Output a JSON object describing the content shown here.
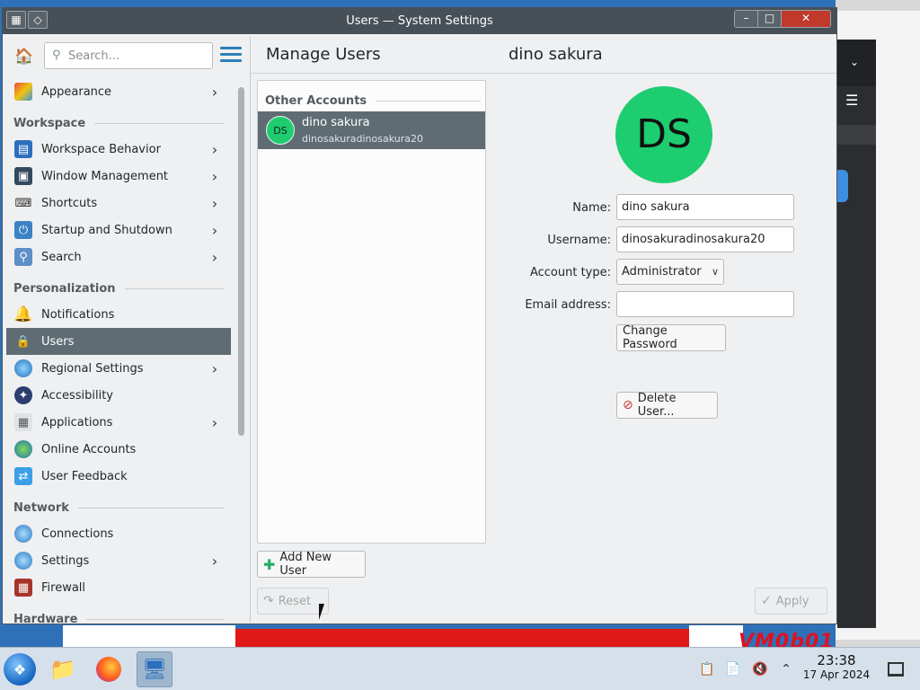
{
  "window": {
    "title": "Users — System Settings"
  },
  "sidebar": {
    "search_placeholder": "Search...",
    "items": [
      {
        "label": "Appearance",
        "icon": "appearance-icon",
        "top": 0,
        "chevron": true
      },
      {
        "label": "Workspace Behavior",
        "icon": "workspace-icon",
        "chevron": true
      },
      {
        "label": "Window Management",
        "icon": "window-icon",
        "chevron": true
      },
      {
        "label": "Shortcuts",
        "icon": "keyboard-icon",
        "chevron": true
      },
      {
        "label": "Startup and Shutdown",
        "icon": "startup-icon",
        "chevron": true
      },
      {
        "label": "Search",
        "icon": "search-icon",
        "chevron": true
      },
      {
        "label": "Notifications",
        "icon": "bell-icon",
        "chevron": false
      },
      {
        "label": "Users",
        "icon": "users-icon",
        "chevron": false,
        "selected": true
      },
      {
        "label": "Regional Settings",
        "icon": "globe-icon",
        "chevron": true
      },
      {
        "label": "Accessibility",
        "icon": "accessibility-icon",
        "chevron": false
      },
      {
        "label": "Applications",
        "icon": "applications-icon",
        "chevron": true
      },
      {
        "label": "Online Accounts",
        "icon": "online-accounts-icon",
        "chevron": false
      },
      {
        "label": "User Feedback",
        "icon": "feedback-icon",
        "chevron": false
      },
      {
        "label": "Connections",
        "icon": "network-icon",
        "chevron": false
      },
      {
        "label": "Settings",
        "icon": "network-settings-icon",
        "chevron": true
      },
      {
        "label": "Firewall",
        "icon": "firewall-icon",
        "chevron": false
      }
    ],
    "sections": [
      "Workspace",
      "Personalization",
      "Network",
      "Hardware"
    ]
  },
  "main": {
    "page_title": "Manage Users",
    "user_title": "dino sakura",
    "accounts_section": "Other Accounts",
    "account": {
      "initials": "DS",
      "name": "dino sakura",
      "username": "dinosakuradinosakura20"
    },
    "add_user_label": "Add New User",
    "reset_label": "Reset",
    "apply_label": "Apply"
  },
  "form": {
    "avatar_initials": "DS",
    "name_label": "Name:",
    "name_value": "dino sakura",
    "username_label": "Username:",
    "username_value": "dinosakuradinosakura20",
    "account_type_label": "Account type:",
    "account_type_value": "Administrator",
    "email_label": "Email address:",
    "email_value": "",
    "change_password_label": "Change Password",
    "delete_user_label": "Delete User..."
  },
  "taskbar": {
    "time": "23:38",
    "date": "17 Apr 2024"
  },
  "desktop": {
    "watermark": "VM0b01"
  },
  "colors": {
    "accent": "#2980b9",
    "selection": "#5f6c73",
    "avatar": "#1dcd6f",
    "titlebar": "#475057"
  }
}
